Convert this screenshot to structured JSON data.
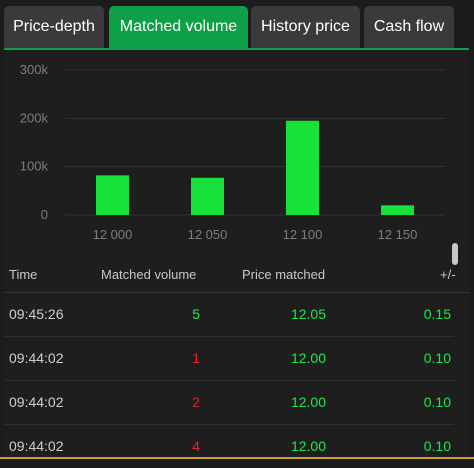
{
  "tabs": [
    {
      "label": "Price-depth"
    },
    {
      "label": "Matched volume"
    },
    {
      "label": "History price"
    },
    {
      "label": "Cash flow"
    }
  ],
  "active_tab": "Matched volume",
  "colors": {
    "accent": "#0ea047",
    "bar": "#16e23a",
    "up": "#21e84a",
    "down": "#e0262b",
    "grid": "#333333"
  },
  "chart_data": {
    "type": "bar",
    "categories": [
      "12 000",
      "12 050",
      "12 100",
      "12 150"
    ],
    "values": [
      82000,
      77000,
      195000,
      20000
    ],
    "ylim": [
      0,
      300000
    ],
    "yticks": [
      0,
      100000,
      200000,
      300000
    ],
    "ytick_labels": [
      "0",
      "100k",
      "200k",
      "300k"
    ],
    "grid": true
  },
  "table": {
    "headers": {
      "time": "Time",
      "volume": "Matched volume",
      "price": "Price matched",
      "change": "+/-"
    },
    "rows": [
      {
        "time": "09:45:26",
        "volume": "5",
        "price": "12.05",
        "change": "0.15",
        "volume_dir": "up"
      },
      {
        "time": "09:44:02",
        "volume": "1",
        "price": "12.00",
        "change": "0.10",
        "volume_dir": "down"
      },
      {
        "time": "09:44:02",
        "volume": "2",
        "price": "12.00",
        "change": "0.10",
        "volume_dir": "down"
      },
      {
        "time": "09:44:02",
        "volume": "4",
        "price": "12.00",
        "change": "0.10",
        "volume_dir": "down"
      }
    ]
  }
}
